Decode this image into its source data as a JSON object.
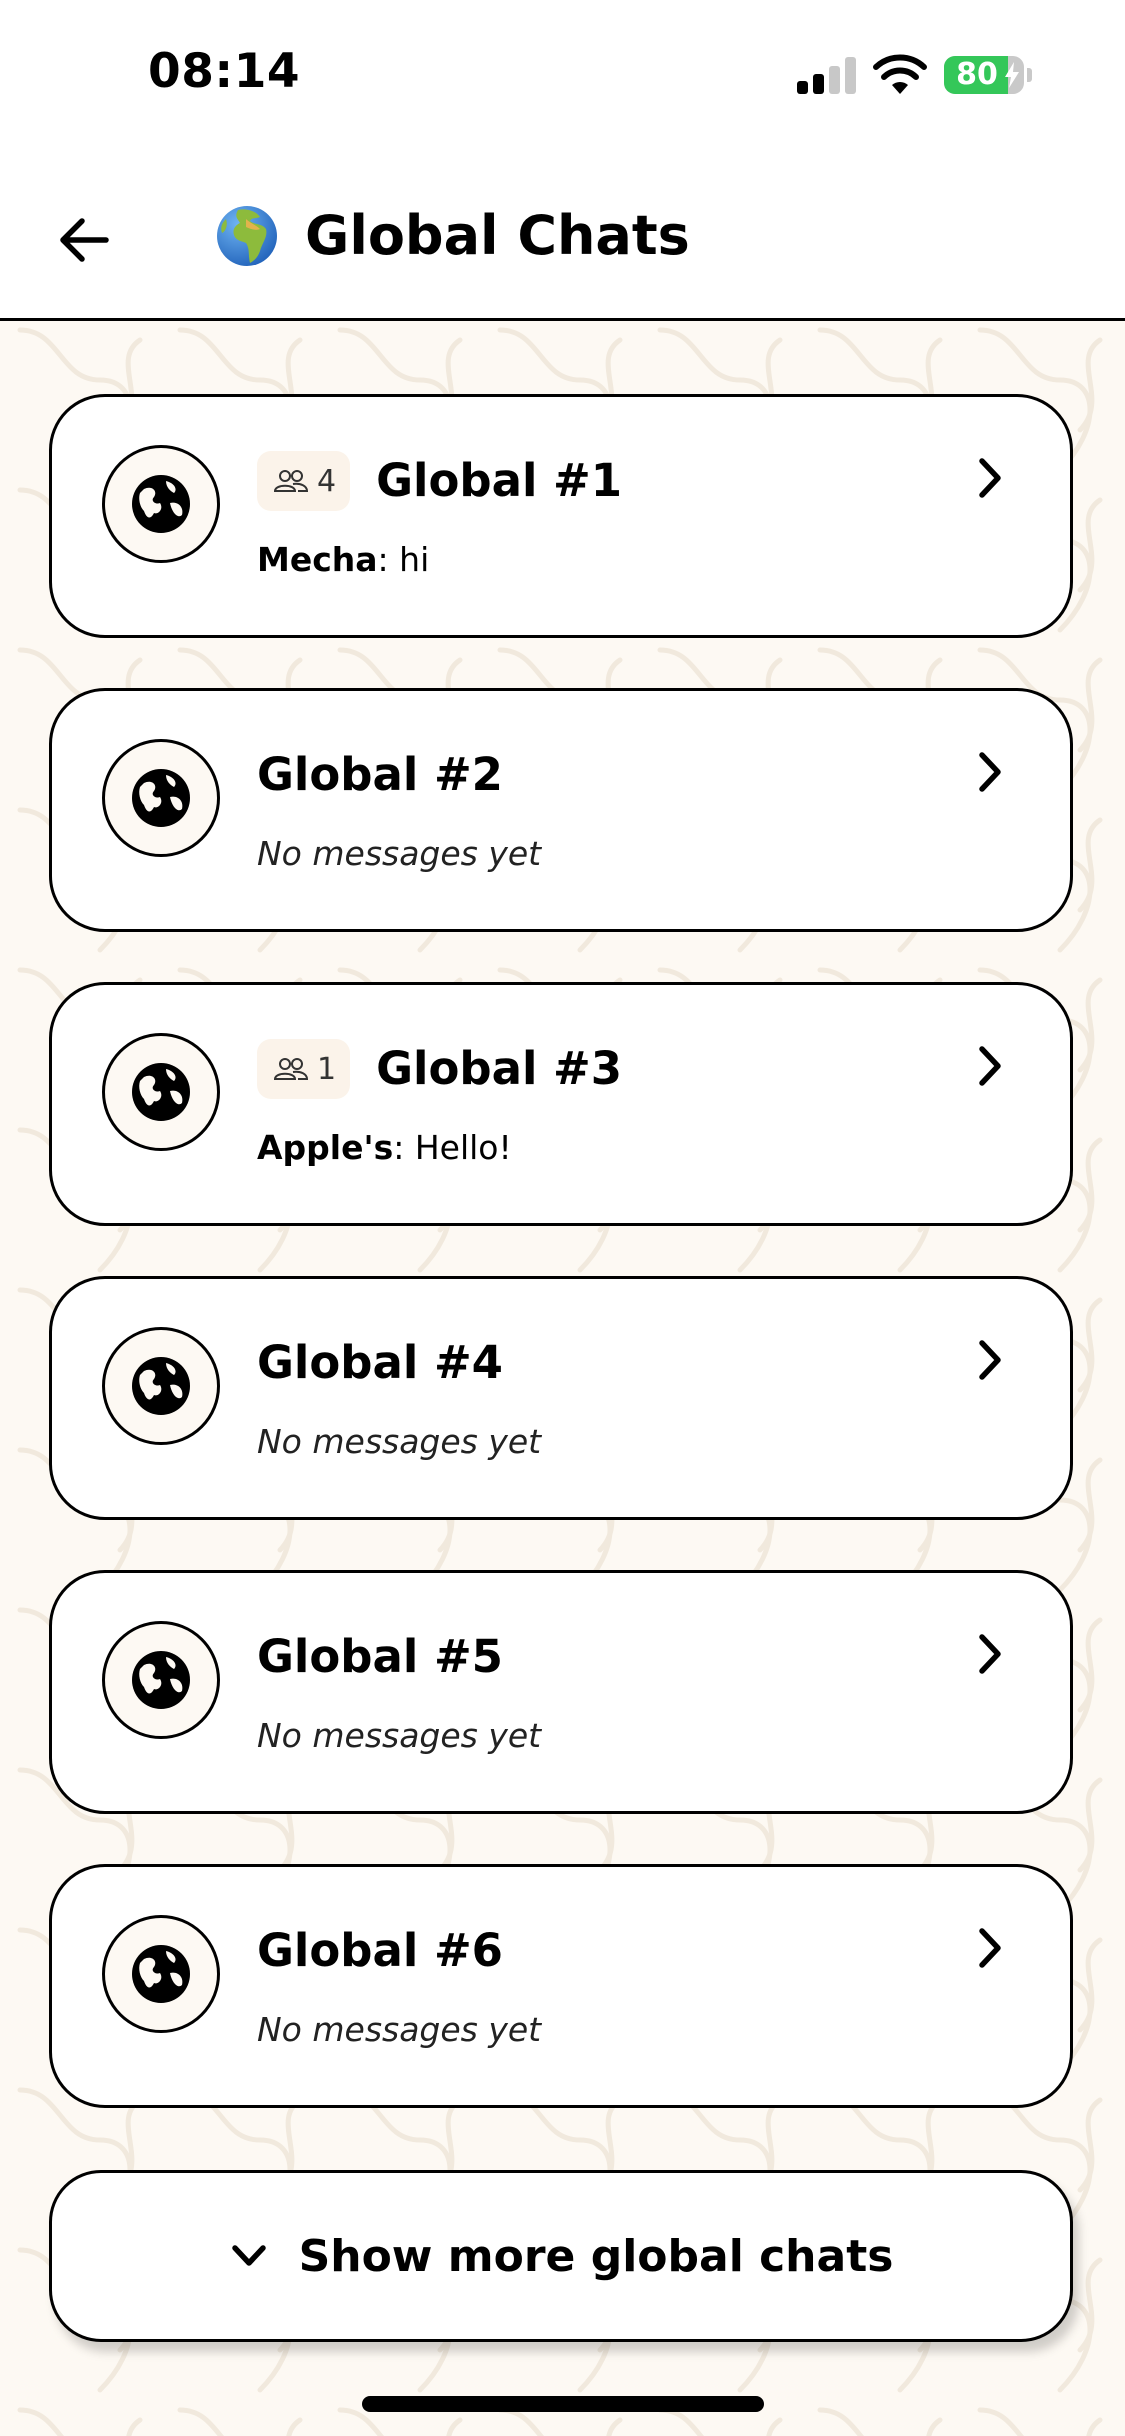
{
  "status_bar": {
    "time": "08:14",
    "battery_level": 80,
    "battery_text": "80",
    "battery_color": "#34c759",
    "signal_bars_active": 2,
    "signal_bars_total": 4
  },
  "nav": {
    "title": "Global Chats",
    "back_icon": "arrow-left-icon",
    "title_emoji_icon": "globe-europe-africa-icon"
  },
  "chats": [
    {
      "title": "Global #1",
      "members": "4",
      "sender": "Mecha",
      "message": "hi"
    },
    {
      "title": "Global #2",
      "members": "",
      "sender": "",
      "message": "No messages yet"
    },
    {
      "title": "Global #3",
      "members": "1",
      "sender": "Apple's",
      "message": "Hello!"
    },
    {
      "title": "Global #4",
      "members": "",
      "sender": "",
      "message": "No messages yet"
    },
    {
      "title": "Global #5",
      "members": "",
      "sender": "",
      "message": "No messages yet"
    },
    {
      "title": "Global #6",
      "members": "",
      "sender": "",
      "message": "No messages yet"
    }
  ],
  "show_more": {
    "label": "Show more global chats",
    "icon": "chevron-down-icon"
  },
  "colors": {
    "background": "#fdf9f3",
    "card": "#ffffff",
    "badge": "#fbf3ea",
    "border": "#000000"
  }
}
